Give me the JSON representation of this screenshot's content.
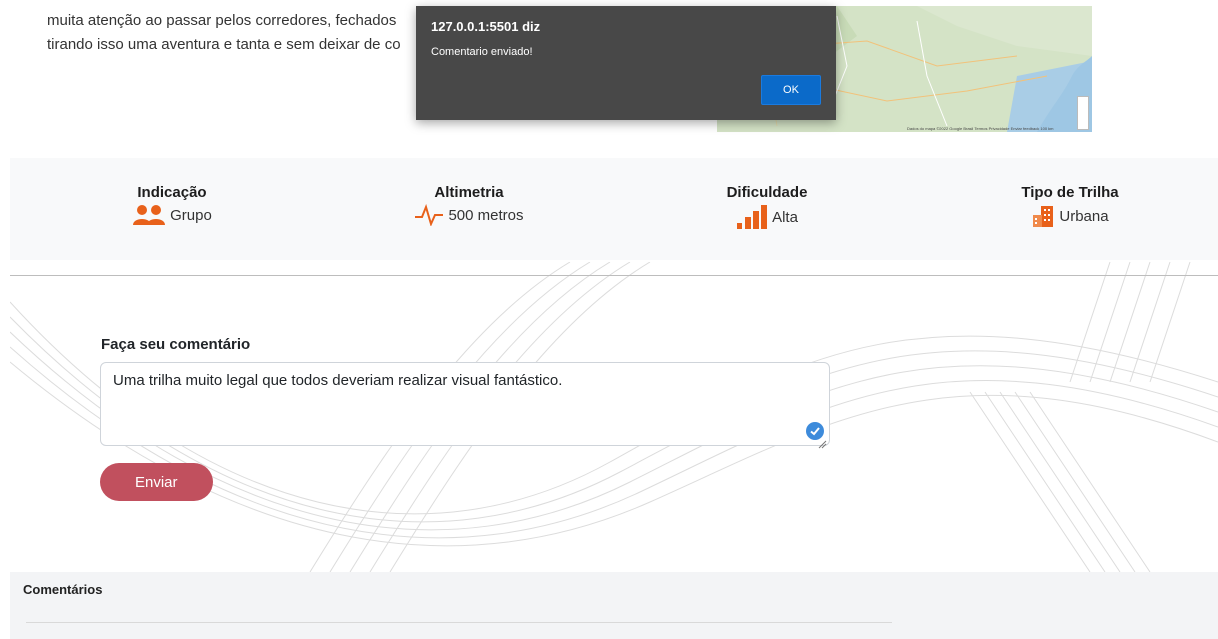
{
  "intro": {
    "line1": "muita atenção ao passar pelos corredores, fechados",
    "line2": "tirando isso uma aventura e tanta e sem deixar de co"
  },
  "map": {
    "attribution": "Dados do mapa ©2022 Google  Brasil  Termos  Privacidade  Enviar feedback  100 km"
  },
  "stats": [
    {
      "title": "Indicação",
      "value": "Grupo",
      "icon": "group-icon"
    },
    {
      "title": "Altimetria",
      "value": "500 metros",
      "icon": "pulse-icon"
    },
    {
      "title": "Dificuldade",
      "value": "Alta",
      "icon": "signal-bars-icon"
    },
    {
      "title": "Tipo de Trilha",
      "value": "Urbana",
      "icon": "building-icon"
    }
  ],
  "form": {
    "label": "Faça seu comentário",
    "value": "Uma trilha muito legal que todos deveriam realizar visual fantástico.",
    "submit_label": "Enviar"
  },
  "comments": {
    "title": "Comentários"
  },
  "dialog": {
    "origin": "127.0.0.1:5501 diz",
    "message": "Comentario enviado!",
    "ok_label": "OK"
  },
  "colors": {
    "accent_orange": "#e8611a",
    "button_red": "#c1505e",
    "dialog_bg": "#484848",
    "dialog_ok": "#0b6ac9"
  }
}
